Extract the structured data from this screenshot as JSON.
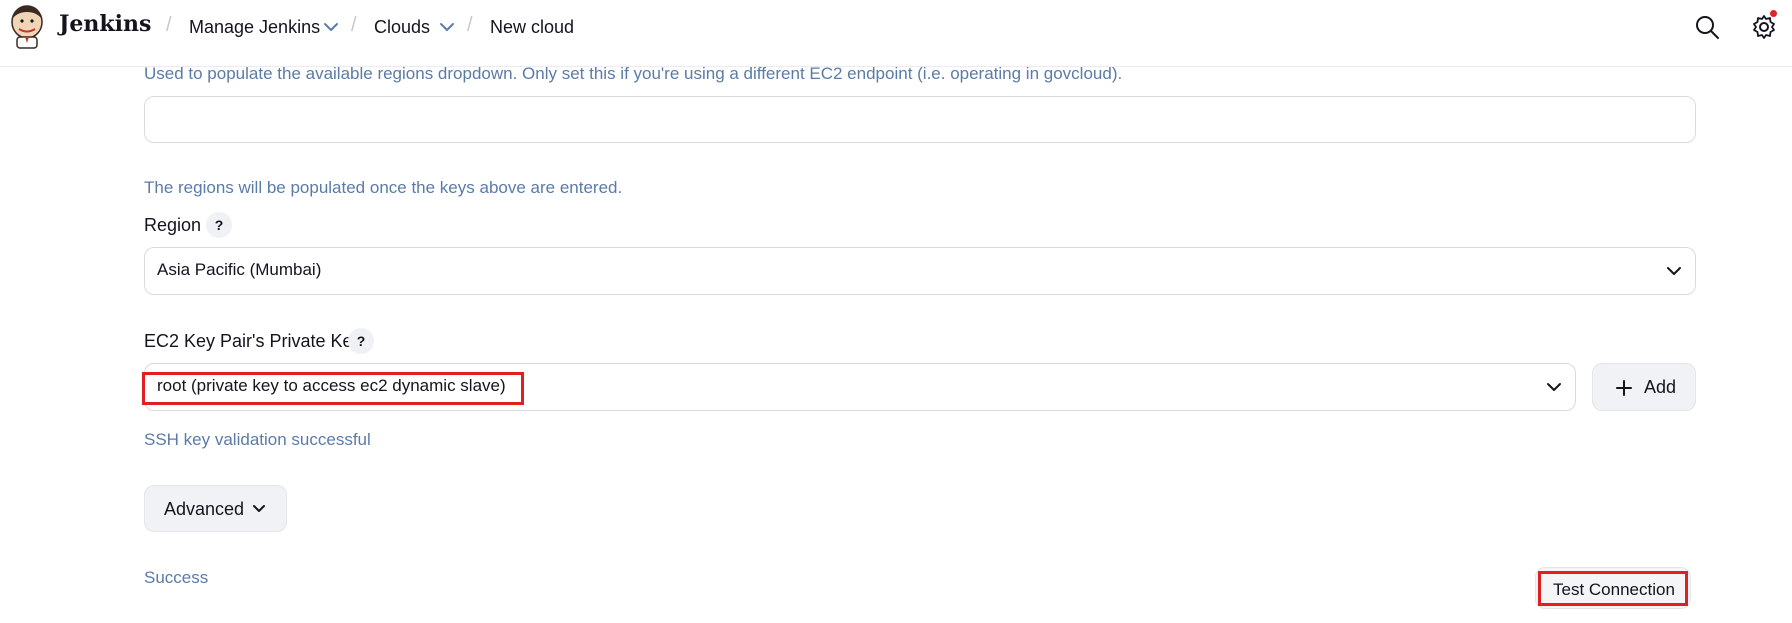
{
  "header": {
    "brand": "Jenkins",
    "breadcrumbs": [
      {
        "label": "Manage Jenkins",
        "has_dropdown": true
      },
      {
        "label": "Clouds",
        "has_dropdown": true
      },
      {
        "label": "New cloud",
        "has_dropdown": false
      }
    ],
    "icons": [
      "search-icon",
      "gear-icon"
    ],
    "notification_dot_color": "#e0242a"
  },
  "endpoint": {
    "help_text": "Used to populate the available regions dropdown. Only set this if you're using a different EC2 endpoint (i.e. operating in govcloud).",
    "value": ""
  },
  "region": {
    "info_text": "The regions will be populated once the keys above are entered.",
    "label": "Region",
    "help_label": "?",
    "selected": "Asia Pacific (Mumbai)"
  },
  "private_key": {
    "label": "EC2 Key Pair's Private Key",
    "help_label": "?",
    "selected": "root (private key to access ec2 dynamic slave)",
    "add_label": "Add",
    "validation": "SSH key validation successful"
  },
  "advanced": {
    "label": "Advanced"
  },
  "test": {
    "status": "Success",
    "button_label": "Test Connection"
  },
  "colors": {
    "help_text": "#5b7ba8",
    "highlight": "#e02020"
  }
}
